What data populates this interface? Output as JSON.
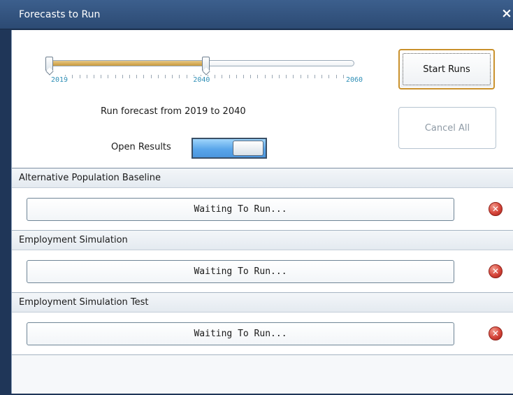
{
  "window": {
    "title": "Forecasts to Run",
    "close_glyph": "×"
  },
  "slider": {
    "min_label": "2019",
    "mid_label": "2040",
    "max_label": "2060",
    "range_start": 2019,
    "range_end": 2040,
    "min": 2019,
    "max": 2060,
    "colors": {
      "fill": "#d4a94f",
      "track": "#ffffff",
      "labels": "#2f8fb6"
    }
  },
  "range_text": "Run forecast from 2019 to 2040",
  "open_results": {
    "label": "Open Results",
    "state": "on"
  },
  "buttons": {
    "start_runs": "Start Runs",
    "cancel_all": "Cancel All"
  },
  "forecasts": [
    {
      "name": "Alternative Population Baseline",
      "status": "Waiting To Run..."
    },
    {
      "name": "Employment Simulation",
      "status": "Waiting To Run..."
    },
    {
      "name": "Employment Simulation Test",
      "status": "Waiting To Run..."
    }
  ],
  "icons": {
    "remove": "remove-circle-icon",
    "remove_color": "#d6453a"
  }
}
